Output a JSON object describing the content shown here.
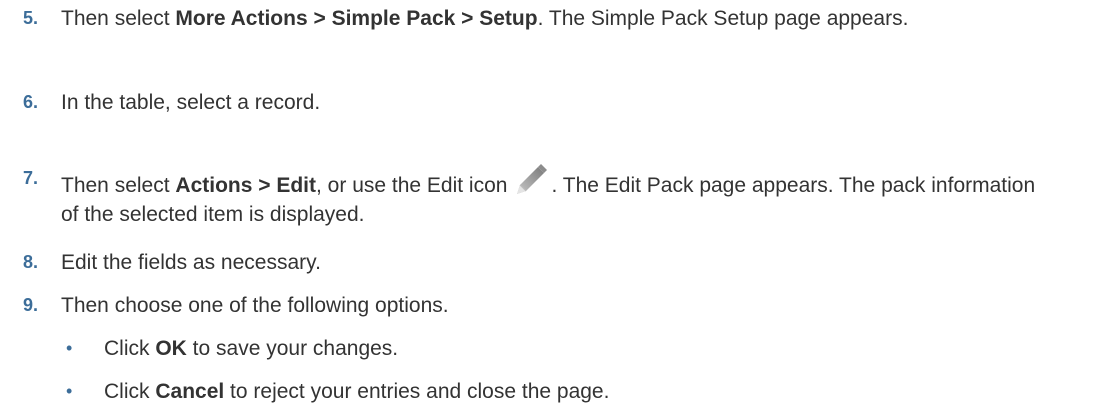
{
  "steps": [
    {
      "number": "5.",
      "pre": "Then select ",
      "bold": "More Actions > Simple Pack > Setup",
      "post": ". The Simple Pack Setup page appears."
    },
    {
      "number": "6.",
      "text": "In the table, select a record."
    },
    {
      "number": "7.",
      "pre": "Then select ",
      "bold": "Actions > Edit",
      "mid": ", or use the Edit icon",
      "post": ". The Edit Pack page appears. The pack information of the selected item is displayed."
    },
    {
      "number": "8.",
      "text": "Edit the fields as necessary."
    },
    {
      "number": "9.",
      "text": "Then choose one of the following options."
    }
  ],
  "bullets": [
    {
      "marker": "•",
      "pre": "Click ",
      "bold": "OK",
      "post": " to save your changes."
    },
    {
      "marker": "•",
      "pre": "Click ",
      "bold": "Cancel",
      "post": " to reject your entries and close the page."
    }
  ],
  "icons": {
    "edit": "pencil-icon"
  },
  "colors": {
    "step_number": "#3c6d99",
    "text": "#333333"
  }
}
